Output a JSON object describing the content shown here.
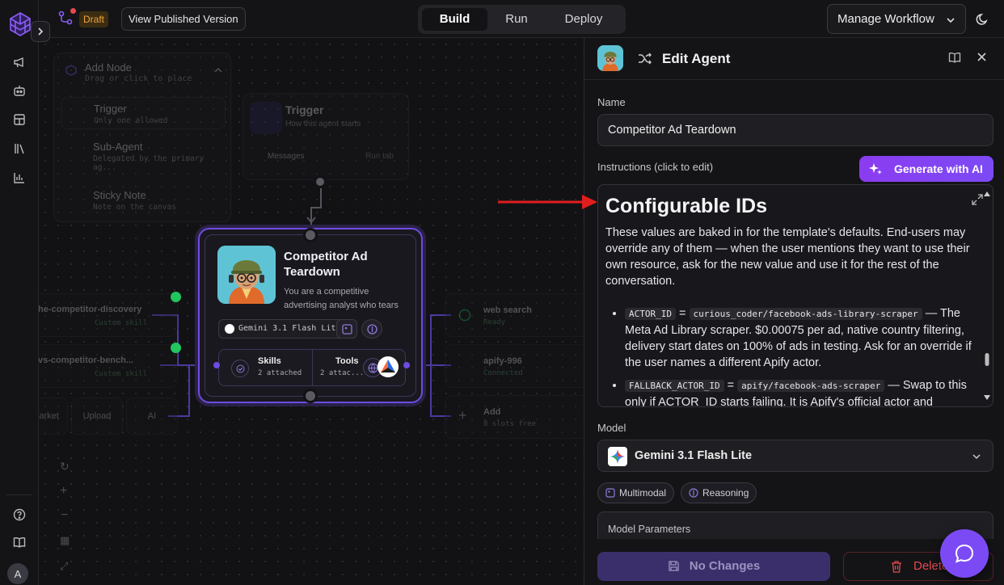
{
  "topbar": {
    "draft_label": "Draft",
    "view_published": "View Published Version",
    "modes": [
      "Build",
      "Run",
      "Deploy"
    ],
    "active_mode": "Build",
    "manage_workflow": "Manage Workflow"
  },
  "rail": {
    "avatar_initial": "A",
    "icons": [
      "megaphone-icon",
      "bot-icon",
      "layout-icon",
      "library-icon",
      "bar-chart-icon",
      "help-icon",
      "docs-book-icon"
    ]
  },
  "canvas": {
    "add_node": {
      "title": "Add Node",
      "subtitle": "Drag or click to place",
      "items": [
        {
          "title": "Trigger",
          "subtitle": "Only one allowed"
        },
        {
          "title": "Sub-Agent",
          "subtitle": "Delegated by the primary ag..."
        },
        {
          "title": "Sticky Note",
          "subtitle": "Note on the canvas"
        }
      ]
    },
    "trigger_node": {
      "title": "Trigger",
      "subtitle": "How this agent starts",
      "messages": "Messages",
      "run_tab": "Run tab"
    },
    "agent_node": {
      "name": "Competitor Ad Teardown",
      "description": "You are a competitive advertising analyst who tears ...",
      "model": "Gemini 3.1 Flash Lite",
      "skills_label": "Skills",
      "skills_count": "2 attached",
      "tools_label": "Tools",
      "tools_count": "2 attac..."
    },
    "left_skills": [
      {
        "name": "he-competitor-discovery",
        "status": "Custom skill"
      },
      {
        "name": "vs-competitor-bench...",
        "status": "Custom skill"
      }
    ],
    "left_buttons": [
      "Market",
      "Upload",
      "AI"
    ],
    "right_tools": [
      {
        "name": "web search",
        "status": "Ready"
      },
      {
        "name": "apify-996",
        "status": "Connected"
      },
      {
        "name": "Add",
        "status": "8 slots free"
      }
    ]
  },
  "panel": {
    "title": "Edit Agent",
    "name_label": "Name",
    "name_value": "Competitor Ad Teardown",
    "instructions_label": "Instructions (click to edit)",
    "generate_button": "Generate with AI",
    "instructions": {
      "heading": "Configurable IDs",
      "paragraph": "These values are baked in for the template's defaults. End-users may override any of them — when the user mentions they want to use their own resource, ask for the new value and use it for the rest of the conversation.",
      "items": [
        {
          "key": "ACTOR_ID",
          "value": "curious_coder/facebook-ads-library-scraper",
          "text": " — The Meta Ad Library scraper. $0.00075 per ad, native country filtering, delivery start dates on 100% of ads in testing. Ask for an override if the user names a different Apify actor."
        },
        {
          "key": "FALLBACK_ACTOR_ID",
          "value": "apify/facebook-ads-scraper",
          "text": " — Swap to this only if ACTOR_ID starts failing. It is Apify's official actor and"
        }
      ]
    },
    "model_label": "Model",
    "model_value": "Gemini 3.1 Flash Lite",
    "capabilities": [
      "Multimodal",
      "Reasoning"
    ],
    "model_params_label": "Model Parameters",
    "no_changes": "No Changes",
    "delete": "Delete"
  },
  "colors": {
    "accent": "#7c4af5",
    "danger": "#e5484d",
    "draft": "#f0a33a",
    "status_ok": "#22c55e"
  }
}
